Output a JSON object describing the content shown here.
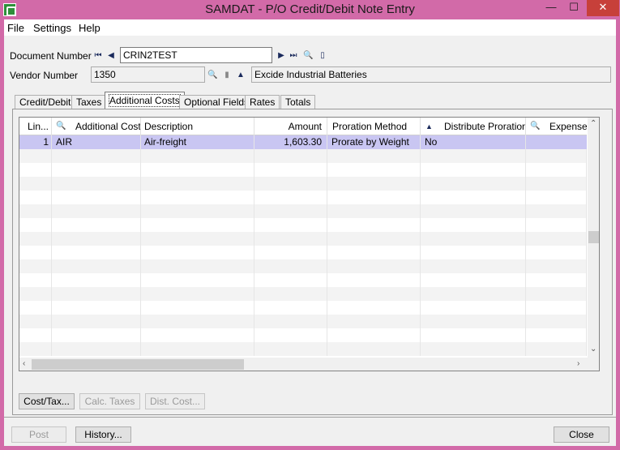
{
  "window": {
    "title": "SAMDAT - P/O Credit/Debit Note Entry",
    "min_glyph": "—",
    "max_glyph": "☐",
    "close_glyph": "✕"
  },
  "menu": [
    "File",
    "Settings",
    "Help"
  ],
  "document": {
    "label": "Document Number",
    "value": "CRIN2TEST"
  },
  "vendor": {
    "label": "Vendor Number",
    "value": "1350",
    "name": "Excide Industrial Batteries"
  },
  "tabs": [
    "Credit/Debit",
    "Taxes",
    "Additional Costs",
    "Optional Fields",
    "Rates",
    "Totals"
  ],
  "active_tab": "Additional Costs",
  "grid": {
    "headers": {
      "line": "Lin...",
      "additional_cost": "Additional Cost",
      "description": "Description",
      "amount": "Amount",
      "proration_method": "Proration Method",
      "distribute_proration": "Distribute Proration",
      "expense": "Expense A"
    },
    "rows": [
      {
        "line": "1",
        "additional_cost": "AIR",
        "description": "Air-freight",
        "amount": "1,603.30",
        "proration_method": "Prorate by Weight",
        "distribute_proration": "No",
        "expense": ""
      }
    ]
  },
  "panel_buttons": {
    "cost_tax": "Cost/Tax...",
    "calc_taxes": "Calc. Taxes",
    "dist_cost": "Dist. Cost..."
  },
  "footer_buttons": {
    "post": "Post",
    "history": "History...",
    "close": "Close"
  },
  "colors": {
    "title_bar": "#d26aa8",
    "selected_row": "#c9c6f2",
    "close_button": "#c7403a"
  }
}
